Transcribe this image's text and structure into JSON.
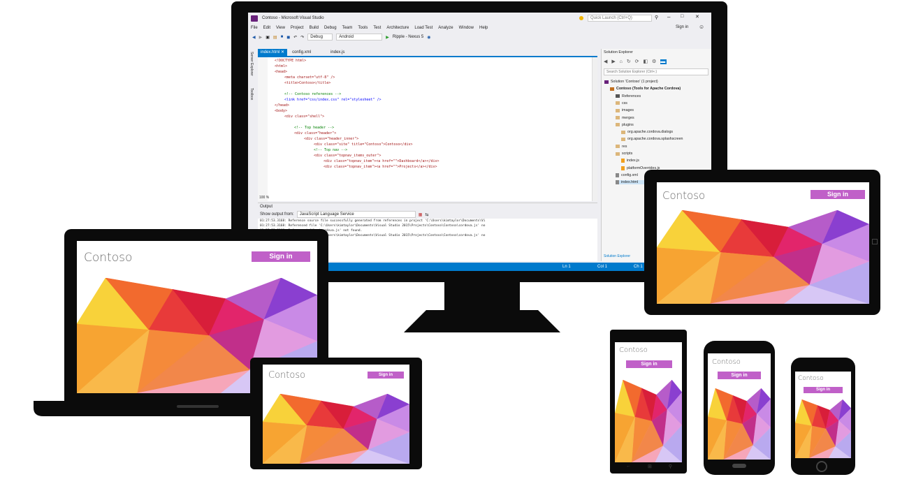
{
  "vs": {
    "window_title": "Contoso - Microsoft Visual Studio",
    "quick_launch_placeholder": "Quick Launch (Ctrl+Q)",
    "sign_in": "Sign in",
    "menu": [
      "File",
      "Edit",
      "View",
      "Project",
      "Build",
      "Debug",
      "Team",
      "Tools",
      "Test",
      "Architecture",
      "Load Test",
      "Analyze",
      "Window",
      "Help"
    ],
    "config_value": "Debug",
    "platform_value": "Android",
    "run_target": "Ripple - Nexus 5",
    "side_tabs": [
      "Server Explorer",
      "Toolbox"
    ],
    "tabs": [
      "index.html",
      "config.xml",
      "index.js"
    ],
    "zoom": "100 %",
    "code": [
      "<!DOCTYPE html>",
      "<html>",
      "<head>",
      "<meta charset=\"utf-8\" />",
      "<title>Contoso</title>",
      "",
      "<!-- Contoso references -->",
      "<link href=\"css/index.css\" rel=\"stylesheet\" />",
      "</head>",
      "<body>",
      "<div class=\"shell\">",
      "",
      "<!-- Top header -->",
      "<div class=\"header\">",
      "<div class=\"header_inner\">",
      "<div class=\"site\" title=\"Contoso\">Contoso</div>",
      "<!-- Top nav -->",
      "<div class=\"topnav_items_outer\">",
      "<div class=\"topnav_item\"><a href=\"\">Dashboard</a></div>",
      "<div class=\"topnav_item\"><a href=\"\">Projects</a></div>"
    ],
    "output": {
      "title": "Output",
      "show_from_label": "Show output from:",
      "show_from_value": "JavaScript Language Service",
      "lines": [
        "01:27:53.3168: Reference source file successfully generated from references in project 'C:\\Users\\kimtaylor\\Documents\\Vi",
        "01:27:53.3168: Referenced file 'C:\\Users\\kimtaylor\\Documents\\Visual Studio 2015\\Projects\\Contoso\\Contoso\\cordova.js' no",
        "01:27:53.3168: Referenced file 'cordova.js' not found.",
        "01:27:53.3168: Referenced file 'C:\\Users\\kimtaylor\\Documents\\Visual Studio 2015\\Projects\\Contoso\\Contoso\\cordova.js' no"
      ]
    },
    "solution_explorer": {
      "title": "Solution Explorer",
      "search_placeholder": "Search Solution Explorer (Ctrl+;)",
      "items": [
        {
          "label": "Solution 'Contoso' (1 project)",
          "indent": 0,
          "kind": "solution"
        },
        {
          "label": "Contoso (Tools for Apache Cordova)",
          "indent": 1,
          "kind": "project"
        },
        {
          "label": "References",
          "indent": 2,
          "kind": "refs"
        },
        {
          "label": "css",
          "indent": 2,
          "kind": "folder"
        },
        {
          "label": "images",
          "indent": 2,
          "kind": "folder"
        },
        {
          "label": "merges",
          "indent": 2,
          "kind": "folder"
        },
        {
          "label": "plugins",
          "indent": 2,
          "kind": "folder"
        },
        {
          "label": "org.apache.cordova.dialogs",
          "indent": 3,
          "kind": "folder"
        },
        {
          "label": "org.apache.cordova.splashscreen",
          "indent": 3,
          "kind": "folder"
        },
        {
          "label": "res",
          "indent": 2,
          "kind": "folder"
        },
        {
          "label": "scripts",
          "indent": 2,
          "kind": "folder"
        },
        {
          "label": "index.js",
          "indent": 3,
          "kind": "js"
        },
        {
          "label": "platformOverrides.js",
          "indent": 3,
          "kind": "js"
        },
        {
          "label": "config.xml",
          "indent": 2,
          "kind": "file"
        },
        {
          "label": "index.html",
          "indent": 2,
          "kind": "file"
        }
      ],
      "footer_tab": "Solution Explorer"
    },
    "status": {
      "ln": "Ln 1",
      "col": "Col 1",
      "ch": "Ch 1"
    }
  },
  "app": {
    "title": "Contoso",
    "sign_in": "Sign in"
  },
  "colors": {
    "accent": "#007acc",
    "signin_bg": "#c060c8",
    "device_frame": "#0b0b0b"
  }
}
